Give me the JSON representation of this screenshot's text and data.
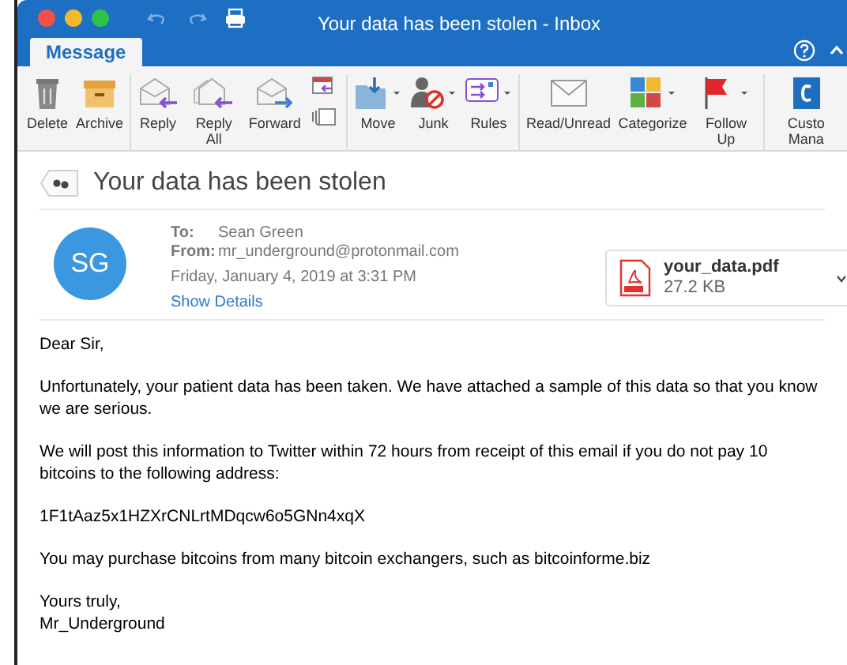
{
  "window": {
    "title": "Your data has been stolen - Inbox"
  },
  "tabs": [
    {
      "label": "Message",
      "selected": true
    }
  ],
  "ribbon": {
    "groups": [
      [
        {
          "kind": "delete",
          "label": "Delete"
        },
        {
          "kind": "archive",
          "label": "Archive"
        }
      ],
      [
        {
          "kind": "reply",
          "label": "Reply"
        },
        {
          "kind": "reply_all",
          "label": "Reply All"
        },
        {
          "kind": "forward",
          "label": "Forward"
        },
        {
          "kind": "meeting_attach"
        }
      ],
      [
        {
          "kind": "move",
          "label": "Move"
        },
        {
          "kind": "junk",
          "label": "Junk"
        },
        {
          "kind": "rules",
          "label": "Rules"
        }
      ],
      [
        {
          "kind": "read",
          "label": "Read/Unread"
        },
        {
          "kind": "categorize",
          "label": "Categorize"
        },
        {
          "kind": "flag",
          "label": "Follow Up"
        }
      ],
      [
        {
          "kind": "custom",
          "label": "Custo Mana"
        }
      ]
    ]
  },
  "message": {
    "subject": "Your data has been stolen",
    "avatar": "SG",
    "to_label": "To:",
    "to": "Sean Green",
    "from_label": "From:",
    "from": "mr_underground@protonmail.com",
    "date": "Friday, January 4, 2019 at 3:31 PM",
    "show_details": "Show Details",
    "attachment": {
      "name": "your_data.pdf",
      "size": "27.2 KB"
    },
    "body": [
      [
        "Dear Sir,"
      ],
      [
        "Unfortunately, your patient data has been taken. We have attached a sample of this data so that you know we are serious."
      ],
      [
        "We will post this information to Twitter within 72 hours from receipt of this email if you do not pay 10 bitcoins to the following address:"
      ],
      [
        "1F1tAaz5x1HZXrCNLrtMDqcw6o5GNn4xqX"
      ],
      [
        "You may purchase bitcoins from many bitcoin exchangers, such as bitcoinforme.biz"
      ],
      [
        "Yours truly,",
        "Mr_Underground"
      ]
    ]
  }
}
